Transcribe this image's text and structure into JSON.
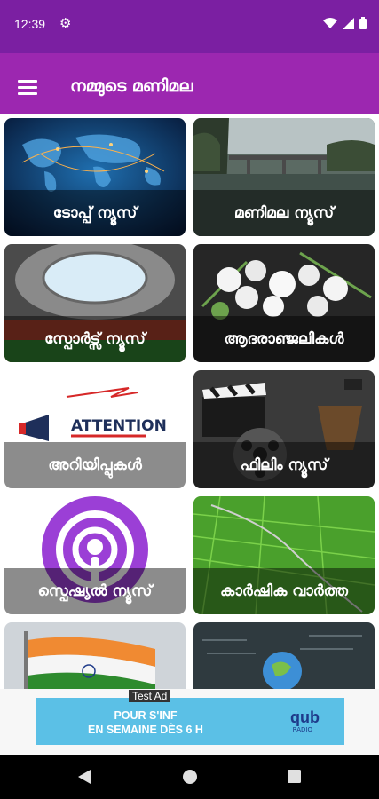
{
  "status": {
    "time": "12:39"
  },
  "app": {
    "title": "നമ്മുടെ മണിമല"
  },
  "tiles": [
    {
      "label": "ടോപ്പ് ന്യൂസ്"
    },
    {
      "label": "മണിമല ന്യൂസ്"
    },
    {
      "label": "സ്പോർട്സ് ന്യൂസ്"
    },
    {
      "label": "ആദരാഞ്ജലികൾ"
    },
    {
      "label": "അറിയിപ്പുകൾ"
    },
    {
      "label": "ഫിലിം ന്യൂസ്"
    },
    {
      "label": "സ്പെഷ്യൽ ന്യൂസ്"
    },
    {
      "label": "കാർഷിക വാർത്ത"
    }
  ],
  "attention_text": "ATTENTION",
  "ad": {
    "tag": "Test Ad",
    "line1": "POUR S'INF",
    "line2": "EN SEMAINE DÈS 6 H",
    "brand": "qub",
    "brand_sub": "RADIO"
  },
  "colors": {
    "primary": "#9c27b0",
    "primary_dark": "#7b1fa2",
    "ad_bg": "#5bc0e6"
  }
}
